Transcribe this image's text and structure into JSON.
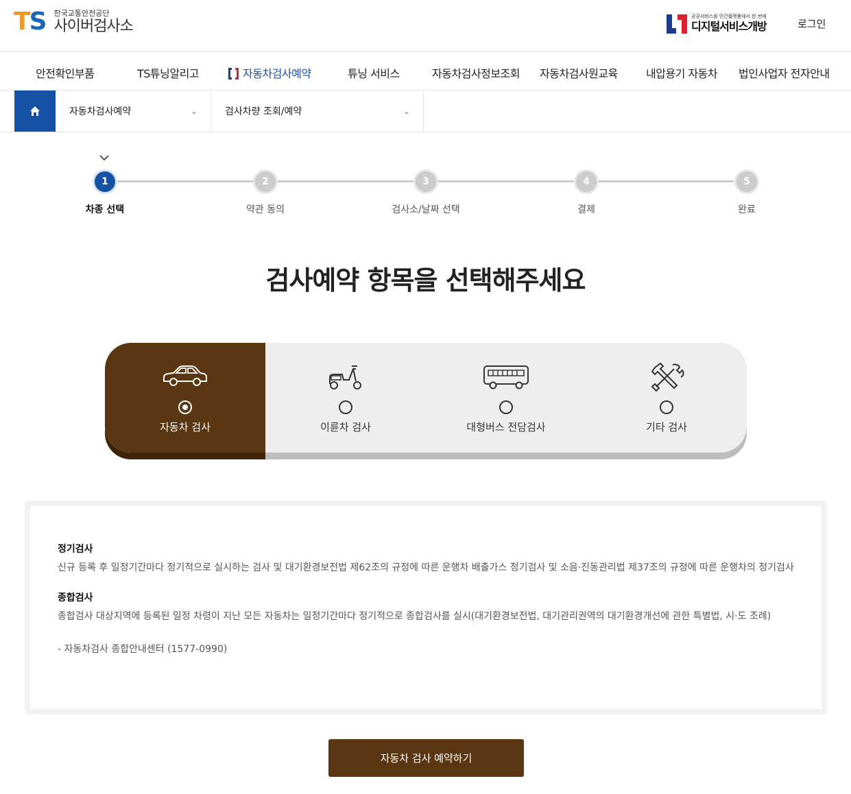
{
  "header": {
    "logo_mark_t": "T",
    "logo_mark_s": "S",
    "org_name": "한국교통안전공단",
    "site_name": "사이버검사소",
    "dsg_tagline": "공공서비스를 민간플랫폼에서 한 번에",
    "dsg_name": "디지털서비스개방",
    "login_label": "로그인"
  },
  "gnb": {
    "items": [
      {
        "label": "안전확인부품"
      },
      {
        "label": "TS튜닝알리고"
      },
      {
        "label": "자동차검사예약",
        "active": true
      },
      {
        "label": "튜닝 서비스"
      },
      {
        "label": "자동차검사정보조회"
      },
      {
        "label": "자동차검사원교육"
      },
      {
        "label": "내압용기 자동차"
      },
      {
        "label": "법인사업자 전자안내"
      }
    ]
  },
  "breadcrumb": {
    "level1": "자동차검사예약",
    "level2": "검사차량 조회/예약"
  },
  "steps": [
    {
      "num": "1",
      "label": "차종 선택",
      "active": true
    },
    {
      "num": "2",
      "label": "약관 동의"
    },
    {
      "num": "3",
      "label": "검사소/날짜 선택"
    },
    {
      "num": "4",
      "label": "결제"
    },
    {
      "num": "5",
      "label": "완료"
    }
  ],
  "headline": "검사예약 항목을 선택해주세요",
  "options": [
    {
      "label": "자동차 검사",
      "icon": "car-icon",
      "selected": true
    },
    {
      "label": "이륜차 검사",
      "icon": "scooter-icon",
      "selected": false
    },
    {
      "label": "대형버스 전담검사",
      "icon": "bus-icon",
      "selected": false
    },
    {
      "label": "기타 검사",
      "icon": "tools-icon",
      "selected": false
    }
  ],
  "info": {
    "sec1_title": "정기검사",
    "sec1_body": "신규 등록 후 일정기간마다 정기적으로 실시하는 검사 및 대기환경보전법 제62조의 규정에 따른 운행차 배출가스 정기검사 및 소음·진동관리법 제37조의 규정에 따른 운행차의 정기검사",
    "sec2_title": "종합검사",
    "sec2_body": "종합검사 대상지역에 등록된 일정 차령이 지난 모든 자동차는 일정기간마다 정기적으로 종합검사를 실시(대기환경보전법, 대기관리권역의 대기환경개선에 관한 특별법, 시·도 조례)",
    "contact": "- 자동차검사 종합안내센터 (1577-0990)"
  },
  "cta_label": "자동차 검사 예약하기",
  "colors": {
    "brand_brown": "#5a3612",
    "brand_blue": "#1552a5",
    "ts_orange": "#f39a1e"
  }
}
